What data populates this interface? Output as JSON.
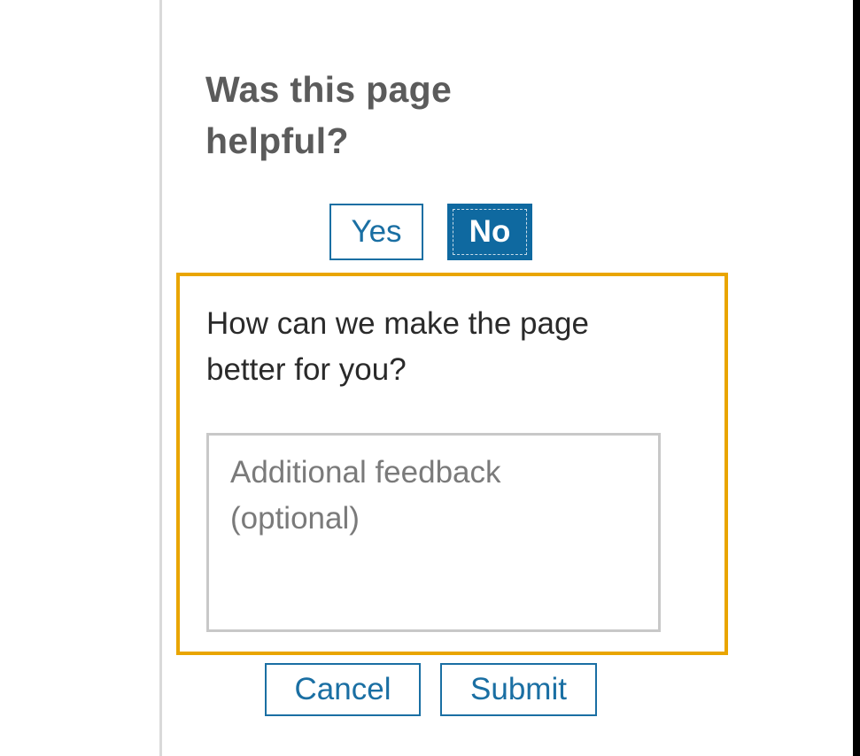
{
  "feedback": {
    "heading": "Was this page helpful?",
    "yes_label": "Yes",
    "no_label": "No",
    "selected": "No",
    "prompt": "How can we make the page better for you?",
    "input_value": "",
    "input_placeholder": "Additional feedback (optional)",
    "cancel_label": "Cancel",
    "submit_label": "Submit"
  },
  "colors": {
    "accent": "#0f69a0",
    "focus_border": "#e9a500",
    "heading_text": "#5b5b5b"
  }
}
